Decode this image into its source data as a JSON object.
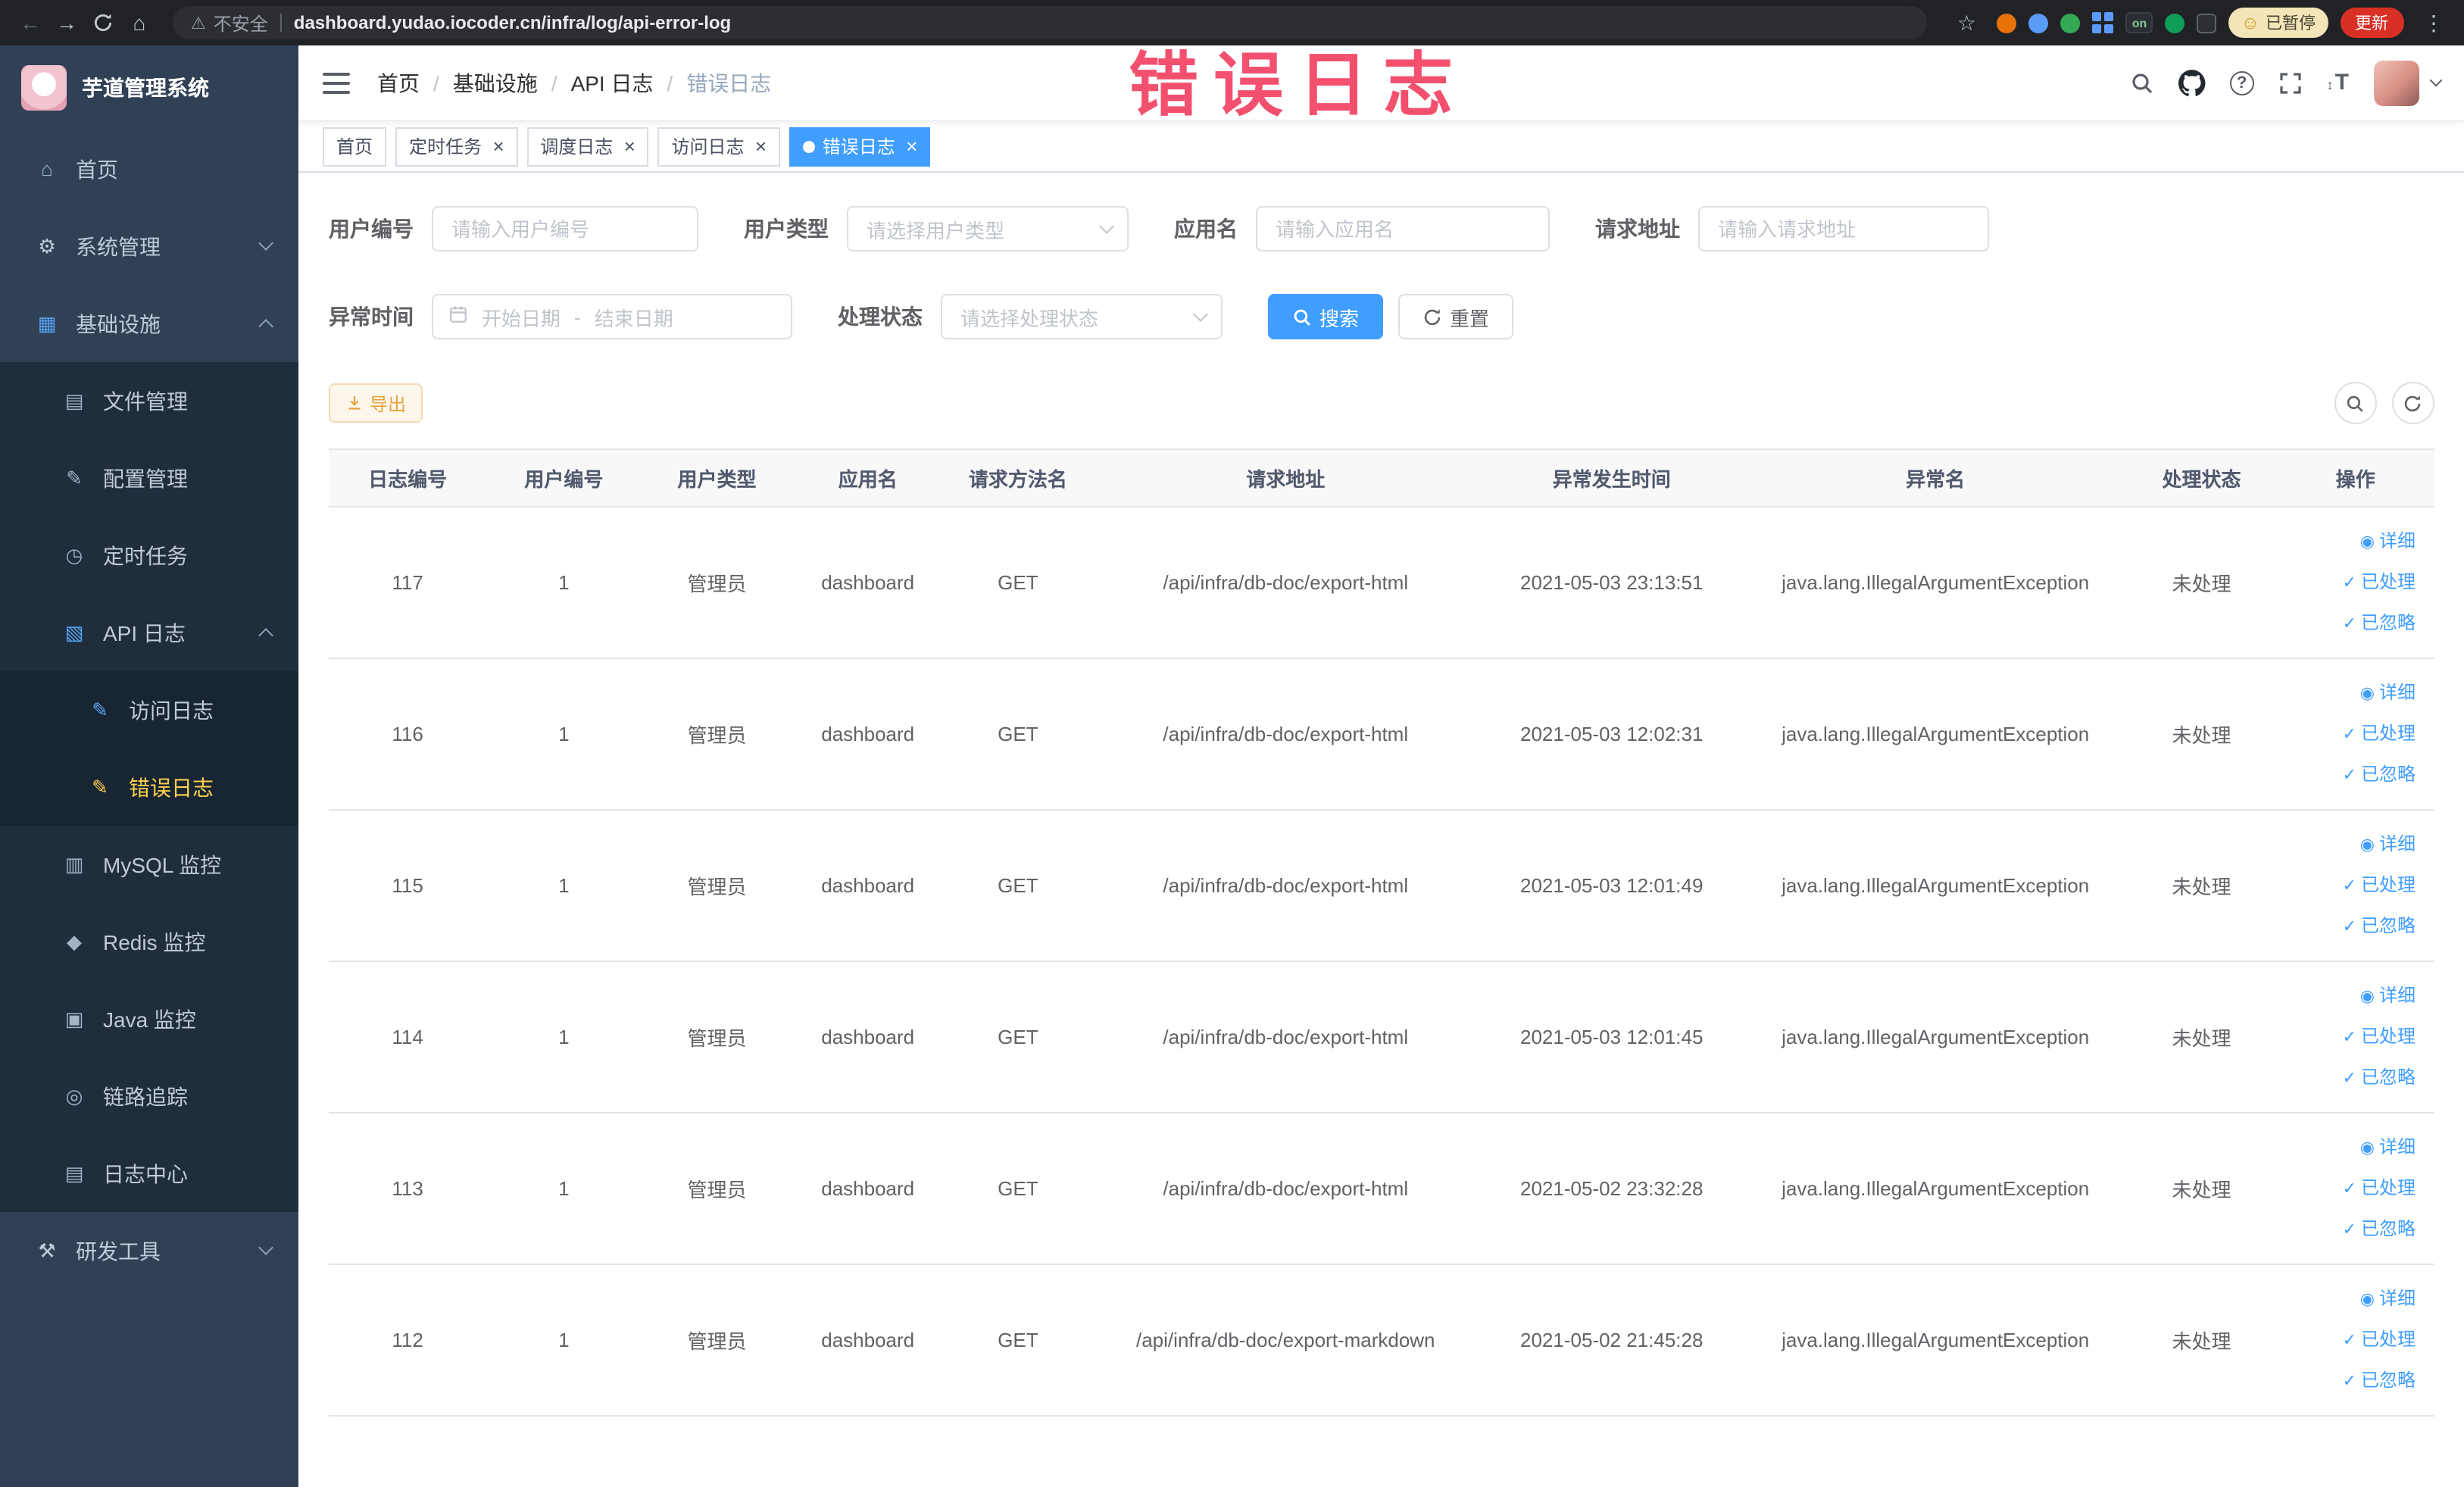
{
  "browser": {
    "security_label": "不安全",
    "url": "dashboard.yudao.iocoder.cn/infra/log/api-error-log",
    "extension_on_badge": "on",
    "paused_badge": "已暂停",
    "update_button": "更新"
  },
  "icons": {
    "back": "←",
    "forward": "→",
    "home": "⌂",
    "star": "☆",
    "warning": "⚠",
    "kebab": "⋮",
    "help": "?",
    "font_size": "T",
    "font_size_arrows": "↕",
    "emoji_face": "☺",
    "eye": "◉",
    "check": "✓"
  },
  "sidebar": {
    "logo_title": "芋道管理系统",
    "menu": [
      {
        "key": "home",
        "label": "首页",
        "level": 1,
        "icon": "home-icon",
        "glyph": "⌂",
        "color": "#a3b4c6"
      },
      {
        "key": "system-mgmt",
        "label": "系统管理",
        "level": 1,
        "icon": "gear-icon",
        "glyph": "⚙",
        "color": "#c0ccda",
        "arrow": "down"
      },
      {
        "key": "infrastructure",
        "label": "基础设施",
        "level": 1,
        "icon": "infrastructure-icon",
        "glyph": "▦",
        "color": "#58a6f5",
        "arrow": "up"
      },
      {
        "key": "file-mgmt",
        "label": "文件管理",
        "level": 2,
        "icon": "file-icon",
        "glyph": "▤",
        "color": "#a3b4c6"
      },
      {
        "key": "config-mgmt",
        "label": "配置管理",
        "level": 2,
        "icon": "config-icon",
        "glyph": "✎",
        "color": "#a3b4c6"
      },
      {
        "key": "scheduled-jobs",
        "label": "定时任务",
        "level": 2,
        "icon": "timer-icon",
        "glyph": "◷",
        "color": "#a3b4c6"
      },
      {
        "key": "api-logs",
        "label": "API 日志",
        "level": 2,
        "icon": "api-log-icon",
        "glyph": "▧",
        "color": "#58a6f5",
        "arrow": "up"
      },
      {
        "key": "access-log",
        "label": "访问日志",
        "level": 3,
        "icon": "access-log-icon",
        "glyph": "✎",
        "color": "#58a6f5"
      },
      {
        "key": "error-log",
        "label": "错误日志",
        "level": 3,
        "icon": "error-log-icon",
        "glyph": "✎",
        "color": "#ffd04b",
        "active": true
      },
      {
        "key": "mysql-monitor",
        "label": "MySQL 监控",
        "level": 2,
        "icon": "mysql-icon",
        "glyph": "▥",
        "color": "#a3b4c6"
      },
      {
        "key": "redis-monitor",
        "label": "Redis 监控",
        "level": 2,
        "icon": "redis-icon",
        "glyph": "◆",
        "color": "#a3b4c6"
      },
      {
        "key": "java-monitor",
        "label": "Java 监控",
        "level": 2,
        "icon": "java-icon",
        "glyph": "▣",
        "color": "#a3b4c6"
      },
      {
        "key": "link-tracing",
        "label": "链路追踪",
        "level": 2,
        "icon": "trace-icon",
        "glyph": "◎",
        "color": "#a3b4c6"
      },
      {
        "key": "log-center",
        "label": "日志中心",
        "level": 2,
        "icon": "log-center-icon",
        "glyph": "▤",
        "color": "#a3b4c6"
      },
      {
        "key": "dev-tools",
        "label": "研发工具",
        "level": 1,
        "icon": "tools-icon",
        "glyph": "⚒",
        "color": "#c0ccda",
        "arrow": "down"
      }
    ]
  },
  "navbar": {
    "breadcrumb": [
      "首页",
      "基础设施",
      "API 日志",
      "错误日志"
    ]
  },
  "tags": [
    {
      "label": "首页",
      "closable": false,
      "active": false
    },
    {
      "label": "定时任务",
      "closable": true,
      "active": false
    },
    {
      "label": "调度日志",
      "closable": true,
      "active": false
    },
    {
      "label": "访问日志",
      "closable": true,
      "active": false
    },
    {
      "label": "错误日志",
      "closable": true,
      "active": true
    }
  ],
  "filters": {
    "user_id": {
      "label": "用户编号",
      "placeholder": "请输入用户编号"
    },
    "user_type": {
      "label": "用户类型",
      "placeholder": "请选择用户类型"
    },
    "app_name": {
      "label": "应用名",
      "placeholder": "请输入应用名"
    },
    "request_url": {
      "label": "请求地址",
      "placeholder": "请输入请求地址"
    },
    "exception_time": {
      "label": "异常时间",
      "start_placeholder": "开始日期",
      "separator": "-",
      "end_placeholder": "结束日期"
    },
    "process_status": {
      "label": "处理状态",
      "placeholder": "请选择处理状态"
    },
    "search_button": "搜索",
    "reset_button": "重置"
  },
  "toolbar": {
    "export_button": "导出"
  },
  "table": {
    "columns": [
      "日志编号",
      "用户编号",
      "用户类型",
      "应用名",
      "请求方法名",
      "请求地址",
      "异常发生时间",
      "异常名",
      "处理状态",
      "操作"
    ],
    "actions": [
      "详细",
      "已处理",
      "已忽略"
    ],
    "rows": [
      {
        "id": "117",
        "user_id": "1",
        "user_type": "管理员",
        "app": "dashboard",
        "method": "GET",
        "url": "/api/infra/db-doc/export-html",
        "time": "2021-05-03 23:13:51",
        "exception": "java.lang.IllegalArgumentException",
        "status": "未处理"
      },
      {
        "id": "116",
        "user_id": "1",
        "user_type": "管理员",
        "app": "dashboard",
        "method": "GET",
        "url": "/api/infra/db-doc/export-html",
        "time": "2021-05-03 12:02:31",
        "exception": "java.lang.IllegalArgumentException",
        "status": "未处理"
      },
      {
        "id": "115",
        "user_id": "1",
        "user_type": "管理员",
        "app": "dashboard",
        "method": "GET",
        "url": "/api/infra/db-doc/export-html",
        "time": "2021-05-03 12:01:49",
        "exception": "java.lang.IllegalArgumentException",
        "status": "未处理"
      },
      {
        "id": "114",
        "user_id": "1",
        "user_type": "管理员",
        "app": "dashboard",
        "method": "GET",
        "url": "/api/infra/db-doc/export-html",
        "time": "2021-05-03 12:01:45",
        "exception": "java.lang.IllegalArgumentException",
        "status": "未处理"
      },
      {
        "id": "113",
        "user_id": "1",
        "user_type": "管理员",
        "app": "dashboard",
        "method": "GET",
        "url": "/api/infra/db-doc/export-html",
        "time": "2021-05-02 23:32:28",
        "exception": "java.lang.IllegalArgumentException",
        "status": "未处理"
      },
      {
        "id": "112",
        "user_id": "1",
        "user_type": "管理员",
        "app": "dashboard",
        "method": "GET",
        "url": "/api/infra/db-doc/export-markdown",
        "time": "2021-05-02 21:45:28",
        "exception": "java.lang.IllegalArgumentException",
        "status": "未处理"
      }
    ]
  },
  "watermark": "错误日志",
  "colors": {
    "primary": "#409eff",
    "sidebar_bg": "#304156",
    "submenu_bg": "#1f2d3d",
    "active_menu_text": "#ffd04b",
    "warning_button": "#e6a23c",
    "watermark": "#f24264"
  }
}
